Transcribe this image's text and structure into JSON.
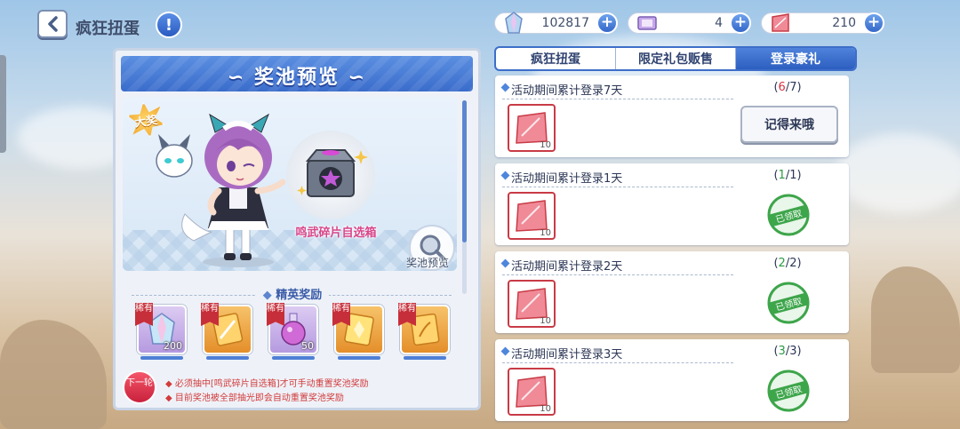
{
  "header": {
    "back_icon": "chevron-left-icon",
    "title": "疯狂扭蛋",
    "info_icon": "exclamation-icon"
  },
  "currencies": [
    {
      "name": "gem",
      "icon": "gem-icon",
      "value": "102817"
    },
    {
      "name": "ticket",
      "icon": "ticket-icon",
      "value": "4"
    },
    {
      "name": "fragment",
      "icon": "pink-crystal-icon",
      "value": "210"
    }
  ],
  "pool": {
    "title": "奖池预览",
    "grand_badge": "大奖",
    "chest_label": "鸣武碎片自选箱",
    "zoom_label": "奖池预览",
    "section_title": "精英奖励",
    "rewards": [
      {
        "tag": "稀有",
        "icon": "rainbow-gem-icon",
        "count": "200",
        "bg": "#c9b4e8"
      },
      {
        "tag": "稀有",
        "icon": "orange-sword-card-icon",
        "count": "",
        "bg": "#f0a844"
      },
      {
        "tag": "稀有",
        "icon": "purple-potion-icon",
        "count": "50",
        "bg": "#c9b4e8"
      },
      {
        "tag": "稀有",
        "icon": "gold-crystal-card-icon",
        "count": "",
        "bg": "#f0a844"
      },
      {
        "tag": "稀有",
        "icon": "gold-scroll-card-icon",
        "count": "",
        "bg": "#f0a844"
      }
    ],
    "next_round": "下一轮",
    "notes": [
      "必须抽中[鸣武碎片自选箱]才可手动重置奖池奖励",
      "目前奖池被全部抽光即会自动重置奖池奖励"
    ]
  },
  "tabs": [
    {
      "label": "疯狂扭蛋",
      "active": false
    },
    {
      "label": "限定礼包贩售",
      "active": false
    },
    {
      "label": "登录豪礼",
      "active": true
    }
  ],
  "tasks": [
    {
      "title": "活动期间累计登录7天",
      "current": "6",
      "total": "/7)",
      "item_count": "10",
      "status": "button",
      "button_label": "记得来哦"
    },
    {
      "title": "活动期间累计登录1天",
      "current": "1",
      "total": "/1)",
      "item_count": "10",
      "status": "claimed",
      "stamp_label": "已领取"
    },
    {
      "title": "活动期间累计登录2天",
      "current": "2",
      "total": "/2)",
      "item_count": "10",
      "status": "claimed",
      "stamp_label": "已领取"
    },
    {
      "title": "活动期间累计登录3天",
      "current": "3",
      "total": "/3)",
      "item_count": "10",
      "status": "claimed",
      "stamp_label": "已领取"
    }
  ],
  "colors": {
    "accent": "#3d6ec9",
    "progress_incomplete": "#d8323f",
    "progress_complete": "#2b9a43",
    "claimed_green": "#3da54a"
  }
}
